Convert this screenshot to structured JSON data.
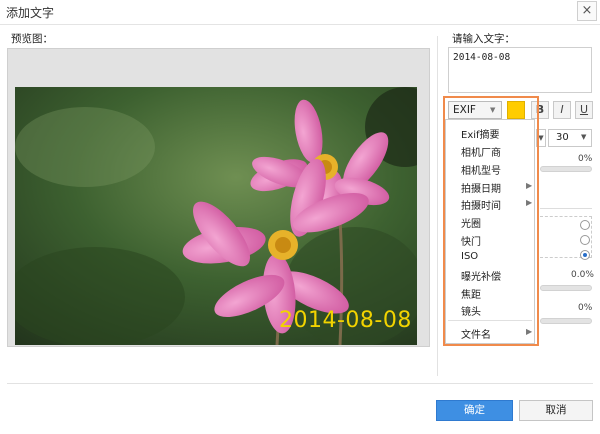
{
  "window": {
    "title": "添加文字",
    "close_glyph": "×"
  },
  "preview": {
    "label": "预览图：",
    "overlay_text": "2014-08-08",
    "overlay_color": "#f2d300"
  },
  "input": {
    "label": "请输入文字：",
    "value": "2014-08-08"
  },
  "toolbar": {
    "exif_label": "EXIF",
    "color": "#ffcc00",
    "bold_label": "B",
    "italic_label": "I",
    "underline_label": "U",
    "font_size": "30"
  },
  "exif_menu": {
    "items": [
      {
        "label": "Exif摘要",
        "has_submenu": false
      },
      {
        "label": "相机厂商",
        "has_submenu": false
      },
      {
        "label": "相机型号",
        "has_submenu": false
      },
      {
        "label": "拍摄日期",
        "has_submenu": true
      },
      {
        "label": "拍摄时间",
        "has_submenu": true
      },
      {
        "label": "光圈",
        "has_submenu": false
      },
      {
        "label": "快门",
        "has_submenu": false
      },
      {
        "label": "ISO",
        "has_submenu": false
      },
      {
        "label": "曝光补偿",
        "has_submenu": false
      },
      {
        "label": "焦距",
        "has_submenu": false
      },
      {
        "label": "镜头",
        "has_submenu": false
      },
      {
        "label": "文件名",
        "has_submenu": true
      }
    ],
    "highlight_color": "#f08a4b"
  },
  "sliders": {
    "pct_1": "0%",
    "pct_2": "0.0%",
    "pct_3": "0%"
  },
  "buttons": {
    "ok": "确定",
    "cancel": "取消",
    "ok_color": "#3e8fe3"
  }
}
